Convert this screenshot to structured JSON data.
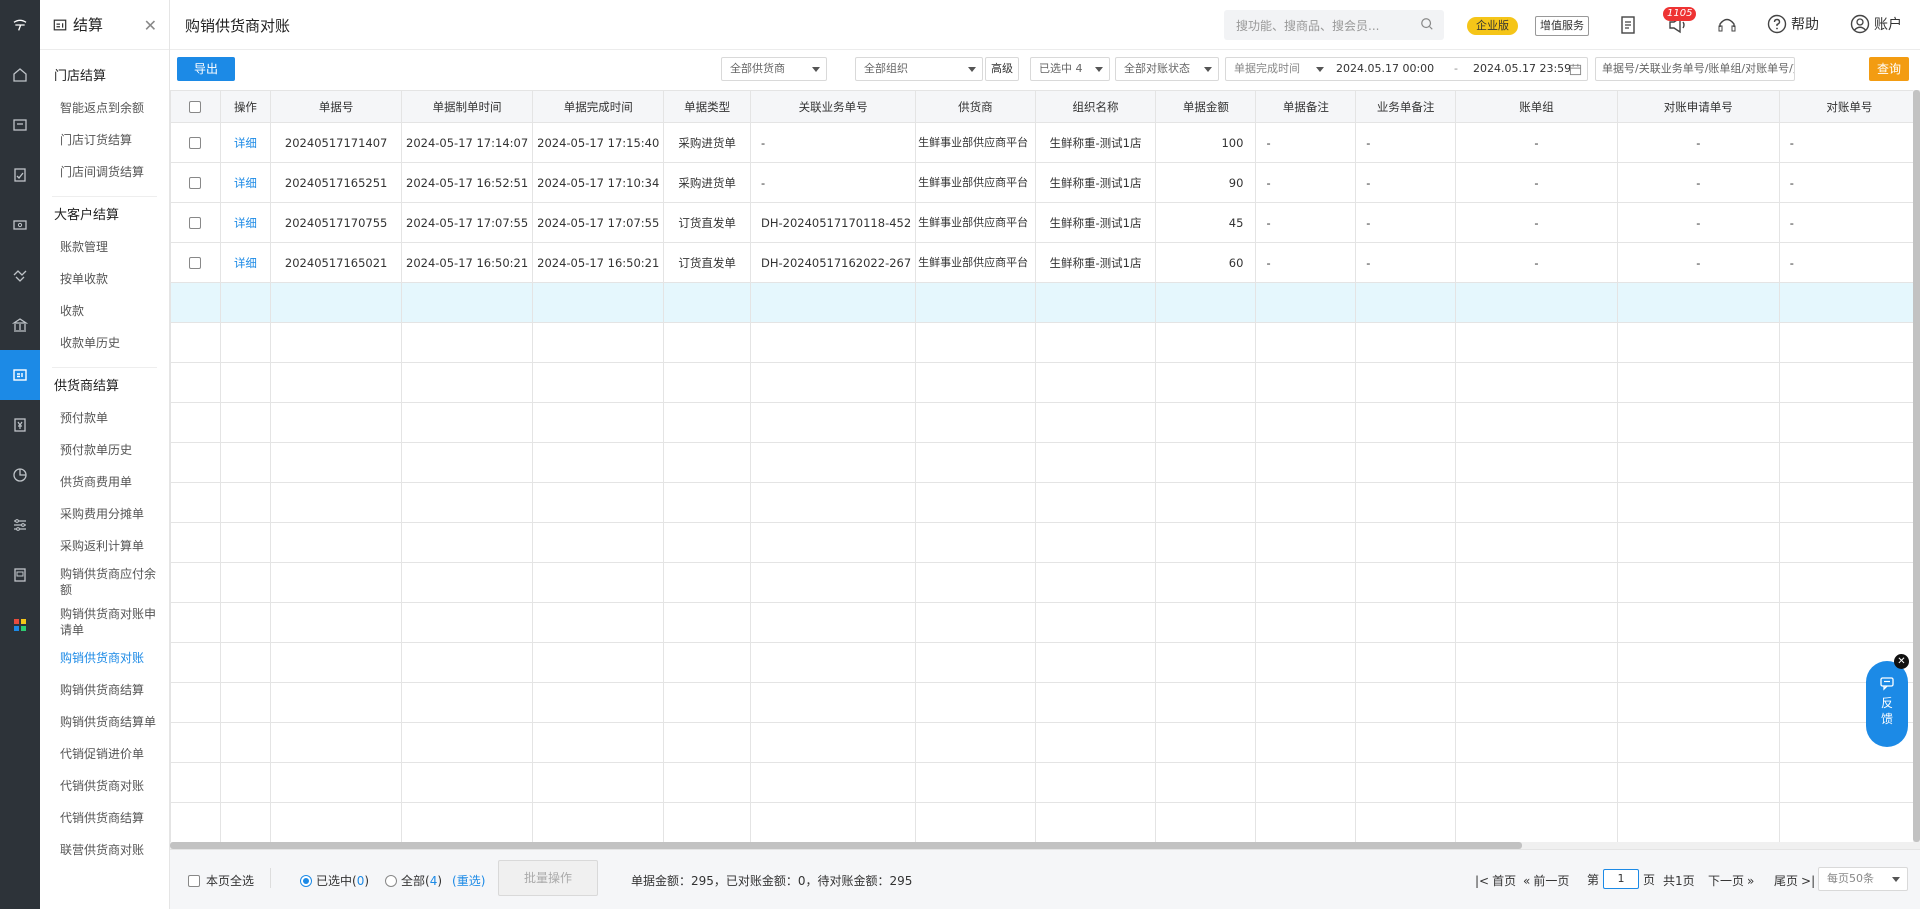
{
  "sidebar": {
    "module_title": "结算",
    "groups": [
      {
        "title": "门店结算",
        "items": [
          "智能返点到余额",
          "门店订货结算",
          "门店间调货结算"
        ]
      },
      {
        "title": "大客户结算",
        "items": [
          "账款管理",
          "按单收款",
          "收款",
          "收款单历史"
        ]
      },
      {
        "title": "供货商结算",
        "items": [
          "预付款单",
          "预付款单历史",
          "供货商费用单",
          "采购费用分摊单",
          "采购返利计算单",
          "购销供货商应付余额",
          "购销供货商对账申请单",
          "购销供货商对账",
          "购销供货商结算",
          "购销供货商结算单",
          "代销促销进价单",
          "代销供货商对账",
          "代销供货商结算",
          "联营供货商对账"
        ]
      }
    ],
    "active_item": "购销供货商对账"
  },
  "header": {
    "page_title": "购销供货商对账",
    "search_placeholder": "搜功能、搜商品、搜会员...",
    "edition_badge": "企业版",
    "value_added": "增值服务",
    "notice_count": "1105",
    "help": "帮助",
    "account": "账户"
  },
  "filters": {
    "export": "导出",
    "supplier": "全部供货商",
    "org": "全部组织",
    "advanced": "高级",
    "selected": "已选中 4",
    "recon_status": "全部对账状态",
    "date_type": "单据完成时间",
    "date_start": "2024.05.17 00:00",
    "date_sep": "-",
    "date_end": "2024.05.17 23:59",
    "keyword_placeholder": "单据号/关联业务单号/账单组/对账单号/对",
    "query": "查询"
  },
  "table": {
    "columns": [
      "操作",
      "单据号",
      "单据制单时间",
      "单据完成时间",
      "单据类型",
      "关联业务单号",
      "供货商",
      "组织名称",
      "单据金额",
      "单据备注",
      "业务单备注",
      "账单组",
      "对账申请单号",
      "对账单号"
    ],
    "rows": [
      {
        "op": "详细",
        "doc_no": "20240517171407",
        "created": "2024-05-17 17:14:07",
        "completed": "2024-05-17 17:15:40",
        "type": "采购进货单",
        "related": "-",
        "supplier": "生鲜事业部供应商平台",
        "org": "生鲜称重-测试1店",
        "amount": "100",
        "doc_remark": "-",
        "biz_remark": "-",
        "bill_group": "-",
        "apply_no": "-",
        "recon_no": "-"
      },
      {
        "op": "详细",
        "doc_no": "20240517165251",
        "created": "2024-05-17 16:52:51",
        "completed": "2024-05-17 17:10:34",
        "type": "采购进货单",
        "related": "-",
        "supplier": "生鲜事业部供应商平台",
        "org": "生鲜称重-测试1店",
        "amount": "90",
        "doc_remark": "-",
        "biz_remark": "-",
        "bill_group": "-",
        "apply_no": "-",
        "recon_no": "-"
      },
      {
        "op": "详细",
        "doc_no": "20240517170755",
        "created": "2024-05-17 17:07:55",
        "completed": "2024-05-17 17:07:55",
        "type": "订货直发单",
        "related": "DH-20240517170118-452",
        "supplier": "生鲜事业部供应商平台",
        "org": "生鲜称重-测试1店",
        "amount": "45",
        "doc_remark": "-",
        "biz_remark": "-",
        "bill_group": "-",
        "apply_no": "-",
        "recon_no": "-"
      },
      {
        "op": "详细",
        "doc_no": "20240517165021",
        "created": "2024-05-17 16:50:21",
        "completed": "2024-05-17 16:50:21",
        "type": "订货直发单",
        "related": "DH-20240517162022-267",
        "supplier": "生鲜事业部供应商平台",
        "org": "生鲜称重-测试1店",
        "amount": "60",
        "doc_remark": "-",
        "biz_remark": "-",
        "bill_group": "-",
        "apply_no": "-",
        "recon_no": "-"
      }
    ]
  },
  "footer": {
    "select_page": "本页全选",
    "selected_prefix": "已选中(",
    "selected_count": "0",
    "selected_suffix": ")",
    "all_prefix": "全部(",
    "all_count": "4",
    "all_suffix": ")",
    "reselect": "(重选)",
    "batch": "批量操作",
    "summary": "单据金额：295，已对账金额：0，待对账金额：295",
    "first": "首页",
    "prev": "前一页",
    "page_label": "第",
    "page_value": "1",
    "page_unit": "页",
    "total_pages": "共1页",
    "next": "下一页",
    "last": "尾页",
    "per_page": "每页50条"
  },
  "feedback": {
    "line1": "反",
    "line2": "馈"
  },
  "colors": {
    "primary": "#1c8ae6",
    "query": "#f39c12",
    "badge": "#f5c518",
    "rail": "#2d3339",
    "highlight_row": "#e5f7fd"
  }
}
